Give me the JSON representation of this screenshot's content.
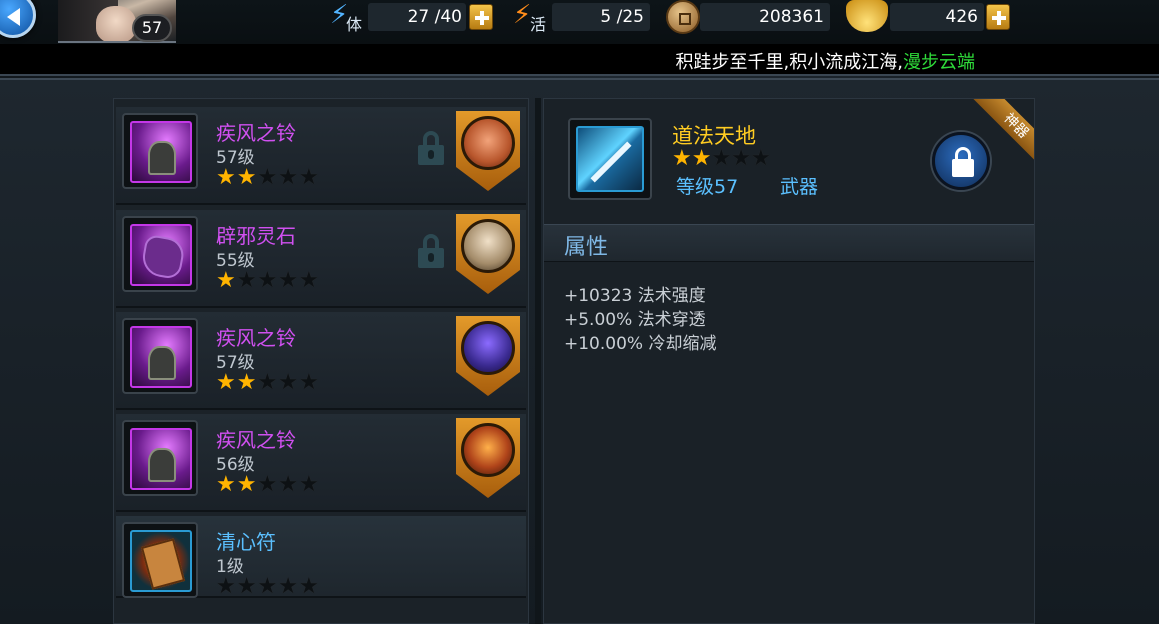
{
  "topbar": {
    "player_level": "57",
    "stamina": {
      "icon": "bolt-icon",
      "char": "体",
      "value": "27 /40"
    },
    "vitality": {
      "icon": "fire-icon",
      "char": "活",
      "value": "5 /25"
    },
    "coins": {
      "icon": "coin-icon",
      "value": "208361"
    },
    "gold": {
      "icon": "ingot-icon",
      "value": "426"
    }
  },
  "marquee": {
    "text": "积跬步至千里,积小流成江海,",
    "highlight": "漫步云端"
  },
  "items": [
    {
      "name": "疾风之铃",
      "level": "57级",
      "stars": 2,
      "rarity": "purple",
      "locked": true,
      "icon": "bell-icon"
    },
    {
      "name": "辟邪灵石",
      "level": "55级",
      "stars": 1,
      "rarity": "purple",
      "locked": true,
      "icon": "stone-icon"
    },
    {
      "name": "疾风之铃",
      "level": "57级",
      "stars": 2,
      "rarity": "purple",
      "locked": false,
      "icon": "bell-icon"
    },
    {
      "name": "疾风之铃",
      "level": "56级",
      "stars": 2,
      "rarity": "purple",
      "locked": false,
      "icon": "bell-icon"
    },
    {
      "name": "清心符",
      "level": "1级",
      "stars": 0,
      "rarity": "blue",
      "locked": false,
      "icon": "charm-icon"
    }
  ],
  "detail": {
    "name": "道法天地",
    "stars": 2,
    "level": "等级57",
    "type": "武器",
    "ribbon": "神器",
    "section_title": "属性",
    "attributes": [
      "+10323 法术强度",
      "+5.00% 法术穿透",
      "+10.00% 冷却缩减"
    ]
  },
  "colors": {
    "purple_rarity": "#d050f0",
    "blue_rarity": "#5bc0ff",
    "gold_name": "#ffcc22",
    "star_gold": "#ffb400",
    "marquee_green": "#2fdc3a"
  }
}
